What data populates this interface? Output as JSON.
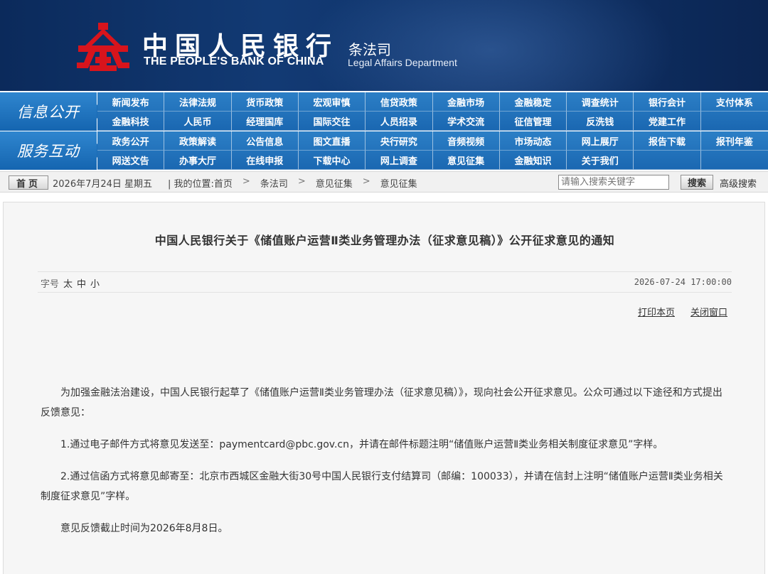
{
  "header": {
    "logo_cn": "中国人民银行",
    "logo_en": "THE PEOPLE'S BANK OF CHINA",
    "dept_cn": "条法司",
    "dept_en": "Legal Affairs Department",
    "emblem_color": "#d8141c"
  },
  "nav": {
    "row1": {
      "category": "信息公开",
      "items": [
        "新闻发布",
        "法律法规",
        "货币政策",
        "宏观审慎",
        "信贷政策",
        "金融市场",
        "金融稳定",
        "调查统计",
        "银行会计",
        "支付体系",
        "金融科技",
        "人民币",
        "经理国库",
        "国际交往",
        "人员招录",
        "学术交流",
        "征信管理",
        "反洗钱",
        "党建工作",
        ""
      ]
    },
    "row2": {
      "category": "服务互动",
      "items": [
        "政务公开",
        "政策解读",
        "公告信息",
        "图文直播",
        "央行研究",
        "音频视频",
        "市场动态",
        "网上展厅",
        "报告下载",
        "报刊年鉴",
        "网送文告",
        "办事大厅",
        "在线申报",
        "下载中心",
        "网上调查",
        "意见征集",
        "金融知识",
        "关于我们",
        "",
        ""
      ]
    }
  },
  "breadcrumb": {
    "home": "首页",
    "date": "2026年7月24日 星期五",
    "location_label": "|  我的位置:首页",
    "path": [
      "条法司",
      "意见征集",
      "意见征集"
    ],
    "separator": ">",
    "search_placeholder": "请输入搜索关键字",
    "search_button": "搜索",
    "advanced_search": "高级搜索"
  },
  "article": {
    "title": "中国人民银行关于《储值账户运营Ⅱ类业务管理办法（征求意见稿）》公开征求意见的通知",
    "font_size_label": "字号",
    "font_sizes": [
      "太",
      "中",
      "小"
    ],
    "publish_time": "2026-07-24 17:00:00",
    "print_link": "打印本页",
    "close_link": "关闭窗口",
    "paragraphs": [
      "为加强金融法治建设，中国人民银行起草了《储值账户运营Ⅱ类业务管理办法（征求意见稿）》，现向社会公开征求意见。公众可通过以下途径和方式提出反馈意见：",
      "1.通过电子邮件方式将意见发送至：paymentcard@pbc.gov.cn，并请在邮件标题注明“储值账户运营Ⅱ类业务相关制度征求意见”字样。",
      "2.通过信函方式将意见邮寄至：北京市西城区金融大街30号中国人民银行支付结算司（邮编：100033），并请在信封上注明“储值账户运营Ⅱ类业务相关制度征求意见”字样。",
      "意见反馈截止时间为2026年8月8日。"
    ]
  }
}
